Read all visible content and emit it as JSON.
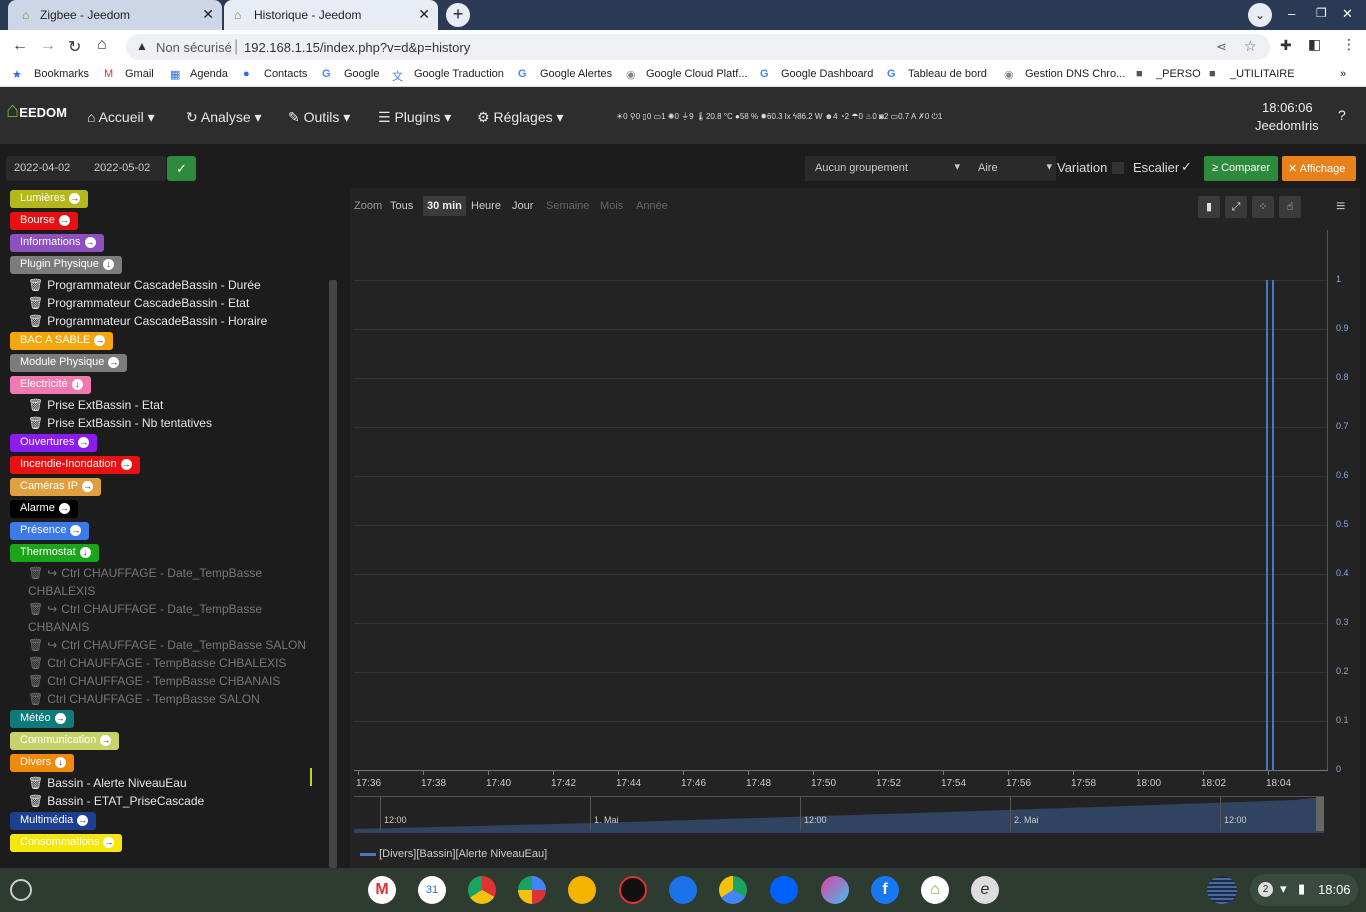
{
  "browser": {
    "tabs": [
      {
        "title": "Zigbee - Jeedom",
        "active": false
      },
      {
        "title": "Historique - Jeedom",
        "active": true
      }
    ],
    "security_label": "Non sécurisé",
    "url": "192.168.1.15/index.php?v=d&p=history",
    "bookmarks": [
      "Bookmarks",
      "Gmail",
      "Agenda",
      "Contacts",
      "Google",
      "Google Traduction",
      "Google Alertes",
      "Google Cloud Platf...",
      "Google Dashboard",
      "Tableau de bord",
      "Gestion DNS Chro...",
      "_PERSO",
      "_UTILITAIRE"
    ]
  },
  "nav": {
    "logo": "EEDOM",
    "menus": [
      "Accueil",
      "Analyse",
      "Outils",
      "Plugins",
      "Réglages"
    ],
    "status_values": [
      "0",
      "0",
      "0",
      "1",
      "0",
      "9",
      "20.8 °C",
      "58 %",
      "60.3 lx",
      "86.2 W",
      "4",
      "2",
      "0",
      "0",
      "2",
      "0.7 A",
      "0",
      "1"
    ],
    "time": "18:06:06",
    "user": "JeedomIris"
  },
  "toolbar": {
    "date_start": "2022-04-02",
    "date_end": "2022-05-02",
    "grouping": "Aucun groupement",
    "chart_type": "Aire",
    "variation_label": "Variation",
    "escalier_label": "Escalier",
    "compare_label": "Comparer",
    "display_label": "Affichage"
  },
  "sidebar": [
    {
      "label": "Lumières",
      "color": "#b5b81d",
      "arrow": "→"
    },
    {
      "label": "Bourse",
      "color": "#e81010",
      "arrow": "→"
    },
    {
      "label": "Informations",
      "color": "#8e4fbf",
      "arrow": "→"
    },
    {
      "label": "Plugin Physique",
      "color": "#7c7c7c",
      "arrow": "↓"
    },
    {
      "label": "Programmateur CascadeBassin - Durée"
    },
    {
      "label": "Programmateur CascadeBassin - Etat"
    },
    {
      "label": "Programmateur CascadeBassin - Horaire"
    },
    {
      "label": "BAC A SABLE",
      "color": "#f5a60c",
      "arrow": "→"
    },
    {
      "label": "Module Physique",
      "color": "#7c7c7c",
      "arrow": "→"
    },
    {
      "label": "Electricité",
      "color": "#f07ab0",
      "arrow": "↓"
    },
    {
      "label": "Prise ExtBassin - Etat"
    },
    {
      "label": "Prise ExtBassin - Nb tentatives"
    },
    {
      "label": "Ouvertures",
      "color": "#8a1cf0",
      "arrow": "→"
    },
    {
      "label": "Incendie-Inondation",
      "color": "#e81010",
      "arrow": "→"
    },
    {
      "label": "Caméras IP",
      "color": "#e0a040",
      "arrow": "→"
    },
    {
      "label": "Alarme",
      "color": "#000000",
      "arrow": "→"
    },
    {
      "label": "Présence",
      "color": "#3c7ae8",
      "arrow": "→"
    },
    {
      "label": "Thermostat",
      "color": "#1aa51a",
      "arrow": "↓"
    },
    {
      "label": "Ctrl CHAUFFAGE - Date_TempBasse",
      "dim": true
    },
    {
      "label": "CHBALEXIS",
      "dim": true
    },
    {
      "label": "Ctrl CHAUFFAGE - Date_TempBasse",
      "dim": true
    },
    {
      "label": "CHBANAIS",
      "dim": true
    },
    {
      "label": "Ctrl CHAUFFAGE - Date_TempBasse SALON",
      "dim": true
    },
    {
      "label": "Ctrl CHAUFFAGE - TempBasse CHBALEXIS",
      "dim": true
    },
    {
      "label": "Ctrl CHAUFFAGE - TempBasse CHBANAIS",
      "dim": true
    },
    {
      "label": "Ctrl CHAUFFAGE - TempBasse SALON",
      "dim": true
    },
    {
      "label": "Météo",
      "color": "#0f7a7a",
      "arrow": "→"
    },
    {
      "label": "Communication",
      "color": "#c7d36a",
      "arrow": "→"
    },
    {
      "label": "Divers",
      "color": "#f08a0c",
      "arrow": "↓"
    },
    {
      "label": "Bassin - Alerte NiveauEau"
    },
    {
      "label": "Bassin - ETAT_PriseCascade"
    },
    {
      "label": "Multimédia",
      "color": "#1c3f8f",
      "arrow": "→"
    },
    {
      "label": "Consommations",
      "color": "#f5e60c",
      "arrow": "→"
    }
  ],
  "chart_data": {
    "type": "area",
    "zoom": {
      "label": "Zoom",
      "options": [
        "Tous",
        "30 min",
        "Heure",
        "Jour",
        "Semaine",
        "Mois",
        "Année"
      ],
      "selected": "30 min"
    },
    "x_ticks": [
      "17:36",
      "17:38",
      "17:40",
      "17:42",
      "17:44",
      "17:46",
      "17:48",
      "17:50",
      "17:52",
      "17:54",
      "17:56",
      "17:58",
      "18:00",
      "18:02",
      "18:04"
    ],
    "y_ticks": [
      "0",
      "0.1",
      "0.2",
      "0.3",
      "0.4",
      "0.5",
      "0.6",
      "0.7",
      "0.8",
      "0.9",
      "1"
    ],
    "ylim": [
      0,
      1
    ],
    "navigator_labels": [
      "12:00",
      "1. Mai",
      "12:00",
      "2. Mai",
      "12:00"
    ],
    "series": [
      {
        "name": "[Divers][Bassin][Alerte NiveauEau]",
        "color": "#4a78c0",
        "pulses": [
          [
            "18:04",
            "18:04"
          ]
        ]
      }
    ]
  },
  "taskbar": {
    "time": "18:06",
    "notif": "2"
  }
}
